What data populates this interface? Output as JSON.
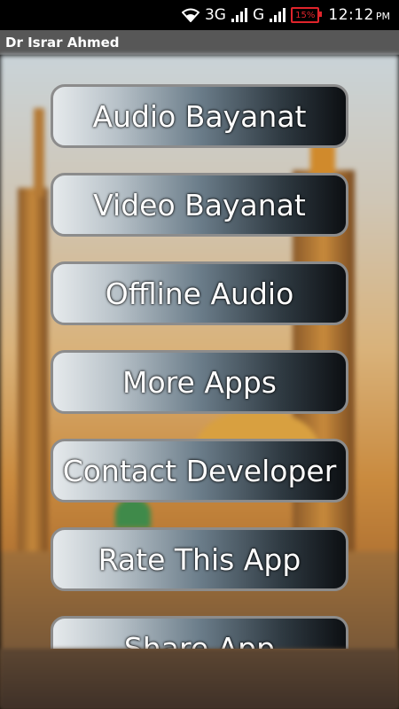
{
  "status_bar": {
    "network_1": "3G",
    "network_2": "G",
    "battery_percent": "15%",
    "time": "12:12",
    "time_suffix": "PM"
  },
  "action_bar": {
    "title": "Dr Israr Ahmed"
  },
  "menu": {
    "items": [
      {
        "label": "Audio Bayanat"
      },
      {
        "label": "Video Bayanat"
      },
      {
        "label": "Offline Audio"
      },
      {
        "label": "More Apps"
      },
      {
        "label": "Contact Developer"
      },
      {
        "label": "Rate This App"
      },
      {
        "label": "Share App"
      }
    ]
  },
  "colors": {
    "status_bar_bg": "#000000",
    "action_bar_bg": "#575757",
    "battery_low": "#e0242b"
  },
  "icons": [
    "wifi-icon",
    "signal-icon",
    "battery-icon"
  ]
}
